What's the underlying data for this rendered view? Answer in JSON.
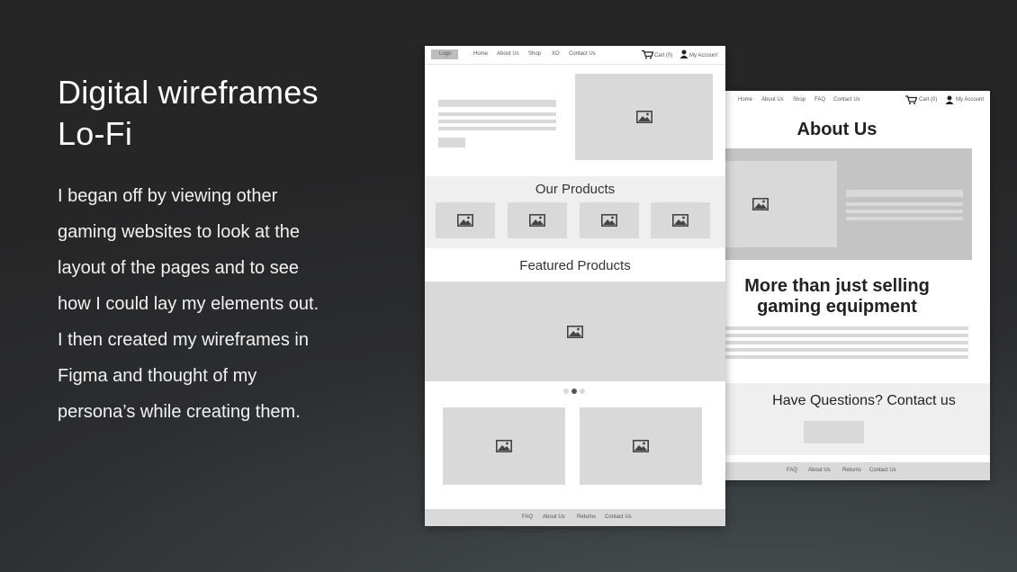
{
  "slide": {
    "title_line1": "Digital wireframes",
    "title_line2": "Lo-Fi",
    "body_lines": [
      "I began off by viewing other",
      "gaming websites to look at the",
      "layout of the pages and to see",
      "how I could lay my elements out.",
      "I then created my wireframes in",
      "Figma and thought of my",
      "persona’s while creating them."
    ]
  },
  "home_wireframe": {
    "logo": "Logo",
    "nav": [
      "Home",
      "About Us",
      "Shop",
      "XO",
      "Contact Us"
    ],
    "cart": "Cart (0)",
    "account": "My Account",
    "our_products": "Our Products",
    "featured_products": "Featured Products",
    "footer": [
      "FAQ",
      "About Us",
      "Returns",
      "Contact Us"
    ]
  },
  "about_wireframe": {
    "nav": [
      "Home",
      "About Us",
      "Shop",
      "FAQ",
      "Contact Us"
    ],
    "cart": "Cart (0)",
    "account": "My Account",
    "heading": "About Us",
    "tagline_line1": "More than just selling",
    "tagline_line2": "gaming equipment",
    "questions": "Have Questions? Contact us",
    "footer": [
      "FAQ",
      "About Us",
      "Returns",
      "Contact Us"
    ]
  },
  "colors": {
    "placeholder": "#d9d9d9",
    "placeholder_dark": "#c4c4c4",
    "band": "#efefef",
    "icon": "#444444"
  },
  "icons": [
    "image-placeholder-icon",
    "cart-icon",
    "user-icon"
  ]
}
